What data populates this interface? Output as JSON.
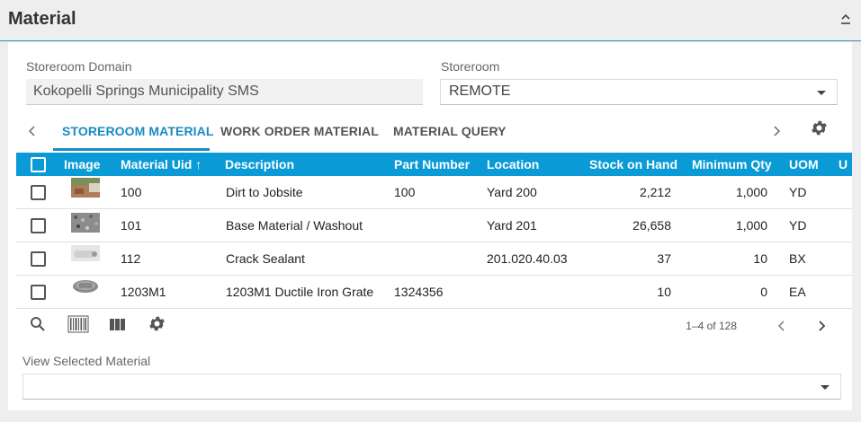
{
  "header": {
    "title": "Material"
  },
  "fields": {
    "storeroom_domain_label": "Storeroom Domain",
    "storeroom_domain_value": "Kokopelli Springs Municipality SMS",
    "storeroom_label": "Storeroom",
    "storeroom_value": "REMOTE"
  },
  "tabs": [
    {
      "label": "STOREROOM MATERIAL",
      "active": true
    },
    {
      "label": "WORK ORDER MATERIAL",
      "active": false
    },
    {
      "label": "MATERIAL QUERY",
      "active": false
    }
  ],
  "table": {
    "columns": [
      "Image",
      "Material Uid ↑",
      "Description",
      "Part Number",
      "Location",
      "Stock on Hand",
      "Minimum Qty",
      "UOM",
      "U"
    ],
    "rows": [
      {
        "uid": "100",
        "description": "Dirt to Jobsite",
        "part_number": "100",
        "location": "Yard 200",
        "stock": "2,212",
        "min_qty": "1,000",
        "uom": "YD"
      },
      {
        "uid": "101",
        "description": "Base Material / Washout",
        "part_number": "",
        "location": "Yard 201",
        "stock": "26,658",
        "min_qty": "1,000",
        "uom": "YD"
      },
      {
        "uid": "112",
        "description": "Crack Sealant",
        "part_number": "",
        "location": "201.020.40.03",
        "stock": "37",
        "min_qty": "10",
        "uom": "BX"
      },
      {
        "uid": "1203M1",
        "description": "1203M1 Ductile Iron Grate",
        "part_number": "1324356",
        "location": "",
        "stock": "10",
        "min_qty": "0",
        "uom": "EA"
      }
    ]
  },
  "pager": {
    "range": "1–4 of 128"
  },
  "view_selected": {
    "label": "View Selected Material",
    "value": ""
  },
  "colors": {
    "accent": "#1a8bc2",
    "table_header": "#0a9ad6"
  }
}
